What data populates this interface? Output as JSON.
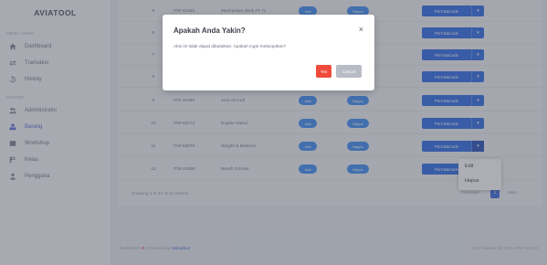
{
  "sidebar": {
    "brand": "AVIATOOL",
    "section_main": "MENU UTAMA",
    "section_master": "MASTER",
    "items": [
      {
        "label": "Dashboard",
        "icon": "home-icon"
      },
      {
        "label": "Transaksi",
        "icon": "swap-icon"
      },
      {
        "label": "History",
        "icon": "history-icon"
      },
      {
        "label": "Administrator",
        "icon": "users-icon"
      },
      {
        "label": "Barang",
        "icon": "box-icon"
      },
      {
        "label": "Workshop",
        "icon": "workshop-icon"
      },
      {
        "label": "Kelas",
        "icon": "class-icon"
      },
      {
        "label": "Pengguna",
        "icon": "user-icon"
      }
    ]
  },
  "table": {
    "rows": [
      {
        "no": "5",
        "code": "ITM-31553",
        "name": "Mechanism deck AT 71",
        "badge1": "Ada",
        "badge2": "Bagus",
        "print": "Print Barcode"
      },
      {
        "no": "6",
        "code": "",
        "name": "",
        "badge1": "",
        "badge2": "",
        "print": "Print Barcode"
      },
      {
        "no": "7",
        "code": "",
        "name": "",
        "badge1": "",
        "badge2": "",
        "print": "Print Barcode"
      },
      {
        "no": "8",
        "code": "",
        "name": "",
        "badge1": "",
        "badge2": "",
        "print": "Print Barcode"
      },
      {
        "no": "9",
        "code": "ITM-40482",
        "name": "Jack Aircraft",
        "badge1": "Ada",
        "badge2": "Bagus",
        "print": "Print Barcode"
      },
      {
        "no": "10",
        "code": "ITM-46173",
        "name": "Engine Stand",
        "badge1": "Ada",
        "badge2": "Bagus",
        "print": "Print Barcode"
      },
      {
        "no": "11",
        "code": "ITM-53870",
        "name": "Weight & Balance",
        "badge1": "Ada",
        "badge2": "Bagus",
        "print": "Print Barcode"
      },
      {
        "no": "12",
        "code": "ITM-24298",
        "name": "Bench Grinder",
        "badge1": "Ada",
        "badge2": "Bagus",
        "print": "Print Barcode"
      }
    ],
    "info": "Showing 1 to 12 of 12 entries",
    "pager": {
      "previous": "Previous",
      "current": "1",
      "next": "Next"
    }
  },
  "dropdown": {
    "edit": "Edit",
    "delete": "Hapus"
  },
  "modal": {
    "title": "Apakah Anda Yakin?",
    "close": "×",
    "body": "Aksi ini tidak dapat dibatalkan. Apakah ingin melanjutkan?",
    "yes": "Yes",
    "cancel": "Cancel"
  },
  "footer": {
    "left_prefix": "Build With",
    "heart": "♥",
    "left_mid": "| Powered by",
    "link": "Winadive",
    "right": "v0.5 • laravel v8.75.0 • PHP v8.0.0"
  },
  "colors": {
    "primary": "#2e6be6",
    "badge": "#3f8df2",
    "danger": "#ef4b3b",
    "cancel": "#b7bcc5",
    "active": "#5a6bd8"
  }
}
